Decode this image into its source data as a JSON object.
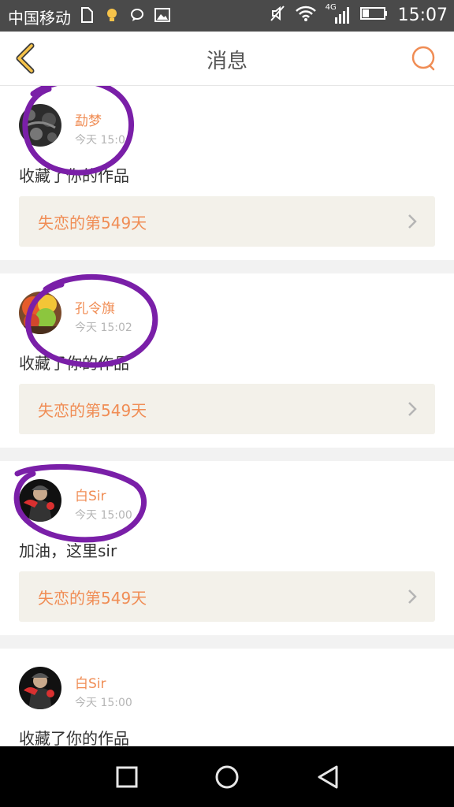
{
  "status_bar": {
    "carrier": "中国移动",
    "network": "4G",
    "time": "15:07",
    "icons": [
      "sim-card-icon",
      "lightbulb-icon",
      "chat-bubble-icon",
      "image-icon",
      "mute-icon",
      "wifi-icon",
      "signal-icon",
      "battery-icon"
    ]
  },
  "header": {
    "title": "消息",
    "back_icon": "chevron-left-icon",
    "search_icon": "search-icon"
  },
  "colors": {
    "accent": "#f08d55",
    "back_arrow": "#f6c34a",
    "annotation": "#7a1fa8",
    "card_bg": "#ffffff",
    "work_bg": "#f3f1ea",
    "page_bg": "#f2f2f2"
  },
  "messages": [
    {
      "user": "勐梦",
      "time": "今天 15:0",
      "text": "收藏了你的作品",
      "work": "失恋的第549天"
    },
    {
      "user": "孔令旗",
      "time": "今天 15:02",
      "text": "收藏了你的作品",
      "work": "失恋的第549天"
    },
    {
      "user": "白Sir",
      "time": "今天 15:00",
      "text": "加油，这里sir",
      "work": "失恋的第549天"
    },
    {
      "user": "白Sir",
      "time": "今天 15:00",
      "text": "收藏了你的作品"
    }
  ],
  "nav": {
    "icons": [
      "recents-square-icon",
      "home-circle-icon",
      "back-triangle-icon"
    ]
  }
}
